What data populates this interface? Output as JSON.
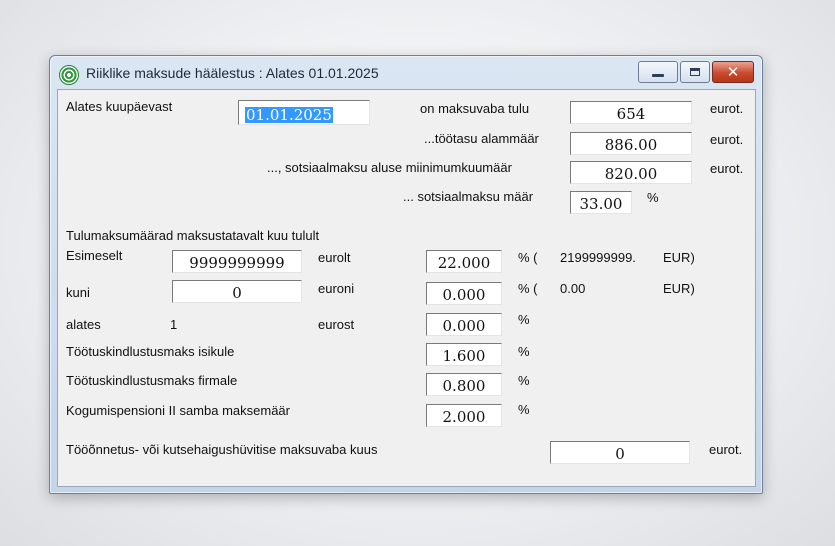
{
  "window": {
    "title": "Riiklike maksude häälestus : Alates 01.01.2025",
    "close_glyph": "✕"
  },
  "form": {
    "date_label": "Alates kuupäevast",
    "date_value": "01.01.2025",
    "tax_free_label": "on maksuvaba tulu",
    "tax_free_value": "654",
    "tax_free_unit": "eurot.",
    "min_wage_label": "...töötasu alammäär",
    "min_wage_value": "886.00",
    "min_wage_unit": "eurot.",
    "social_min_label": "..., sotsiaalmaksu aluse miinimumkuumäär",
    "social_min_value": "820.00",
    "social_min_unit": "eurot.",
    "social_rate_label": "... sotsiaalmaksu määr",
    "social_rate_value": "33.00",
    "social_rate_unit": "%",
    "section_heading": "Tulumaksumäärad maksustatavalt kuu tulult",
    "row1": {
      "label": "Esimeselt",
      "amount": "9999999999",
      "suffix": "eurolt",
      "rate": "22.000",
      "pct": "% (",
      "extra_amount": "2199999999.",
      "extra_cur": "EUR)"
    },
    "row2": {
      "label": "kuni",
      "amount": "0",
      "suffix": "euroni",
      "rate": "0.000",
      "pct": "% (",
      "extra_amount": "0.00",
      "extra_cur": "EUR)"
    },
    "row3": {
      "label": "alates",
      "amount": "1",
      "suffix": "eurost",
      "rate": "0.000",
      "pct": "%"
    },
    "unemp_person_label": "Töötuskindlustusmaks isikule",
    "unemp_person_value": "1.600",
    "unemp_person_pct": "%",
    "unemp_company_label": "Töötuskindlustusmaks firmale",
    "unemp_company_value": "0.800",
    "unemp_company_pct": "%",
    "pension_label": "Kogumispensioni II samba maksemäär",
    "pension_value": "2.000",
    "pension_pct": "%",
    "accident_label": "Tööõnnetus- või kutsehaigushüvitise maksuvaba kuus",
    "accident_value": "0",
    "accident_unit": "eurot."
  }
}
